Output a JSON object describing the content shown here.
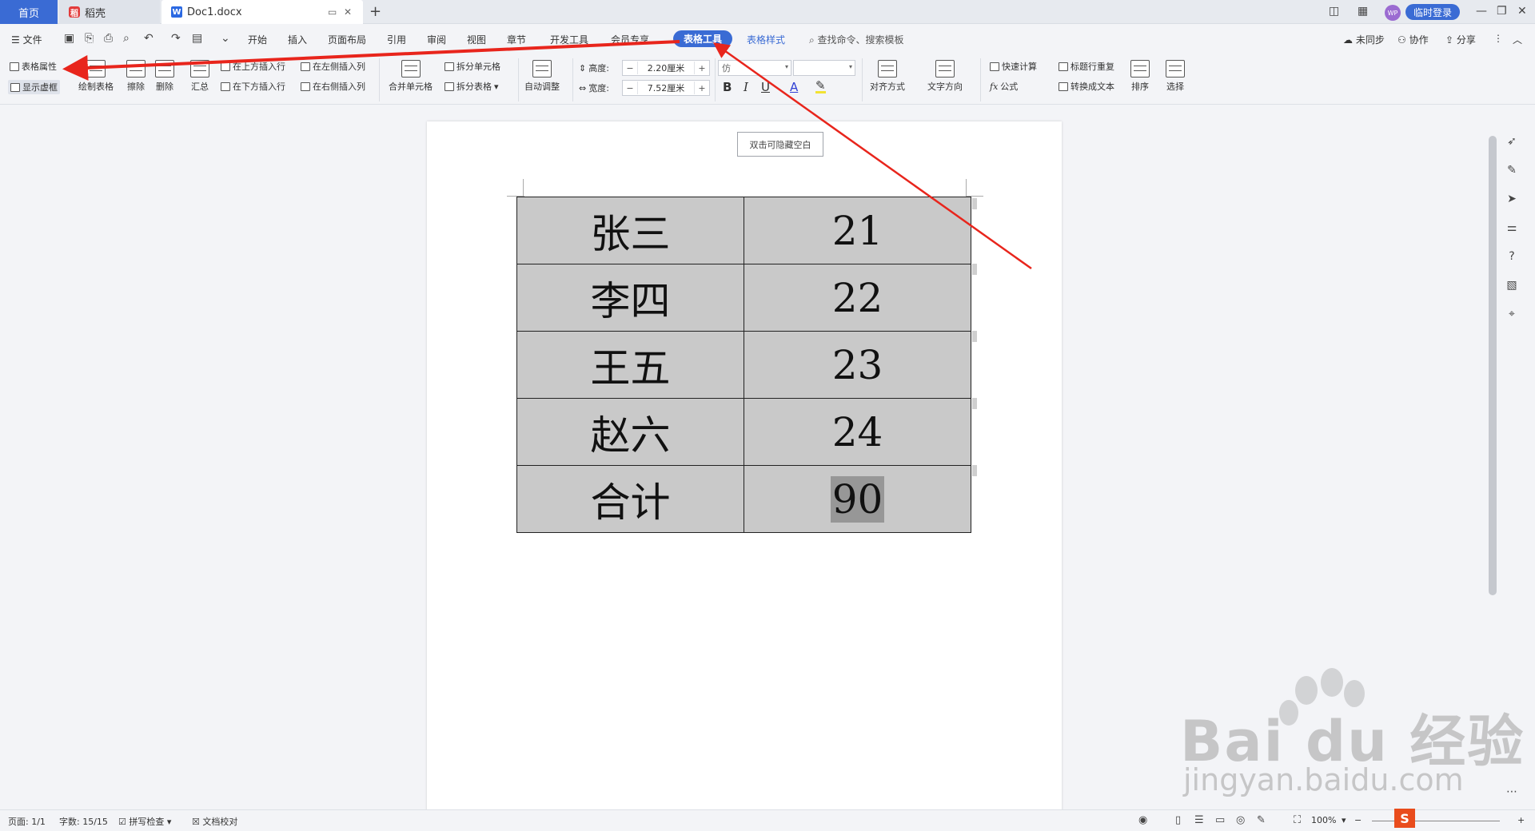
{
  "tabs": {
    "home": "首页",
    "daoke": "稻壳",
    "doc": "Doc1.docx",
    "new_tab": "+",
    "login": "临时登录",
    "avatar": "WP"
  },
  "menu": {
    "file": "文件",
    "items": [
      "开始",
      "插入",
      "页面布局",
      "引用",
      "审阅",
      "视图",
      "章节",
      "开发工具",
      "会员专享"
    ],
    "table_tools": "表格工具",
    "table_style": "表格样式",
    "search": "查找命令、搜索模板",
    "sync": "未同步",
    "collab": "协作",
    "share": "分享"
  },
  "ribbon": {
    "table_props": "表格属性",
    "show_gridlines": "显示虚框",
    "draw_table": "绘制表格",
    "erase": "擦除",
    "delete": "删除",
    "summary": "汇总",
    "insert_above": "在上方插入行",
    "insert_below": "在下方插入行",
    "insert_left": "在左侧插入列",
    "insert_right": "在右侧插入列",
    "merge_cells": "合并单元格",
    "split_cells": "拆分单元格",
    "split_table": "拆分表格",
    "auto_adjust": "自动调整",
    "height_label": "高度:",
    "height_value": "2.20厘米",
    "width_label": "宽度:",
    "width_value": "7.52厘米",
    "font": "仿",
    "align": "对齐方式",
    "text_direction": "文字方向",
    "quick_calc": "快速计算",
    "formula": "公式",
    "repeat_header": "标题行重复",
    "to_text": "转换成文本",
    "sort": "排序",
    "select": "选择"
  },
  "document": {
    "hide_blank": "双击可隐藏空白",
    "table": [
      [
        "张三",
        "21"
      ],
      [
        "李四",
        "22"
      ],
      [
        "王五",
        "23"
      ],
      [
        "赵六",
        "24"
      ],
      [
        "合计",
        "90"
      ]
    ]
  },
  "status": {
    "page": "页面: 1/1",
    "words": "字数: 15/15",
    "spell": "拼写检查",
    "proof": "文档校对",
    "zoom": "100%"
  },
  "watermark": {
    "brand": "Bai du 经验",
    "url": "jingyan.baidu.com"
  },
  "colors": {
    "accent": "#3a6bd4",
    "annotation_arrow": "#e8251c",
    "table_cell": "#c9c9c9"
  }
}
